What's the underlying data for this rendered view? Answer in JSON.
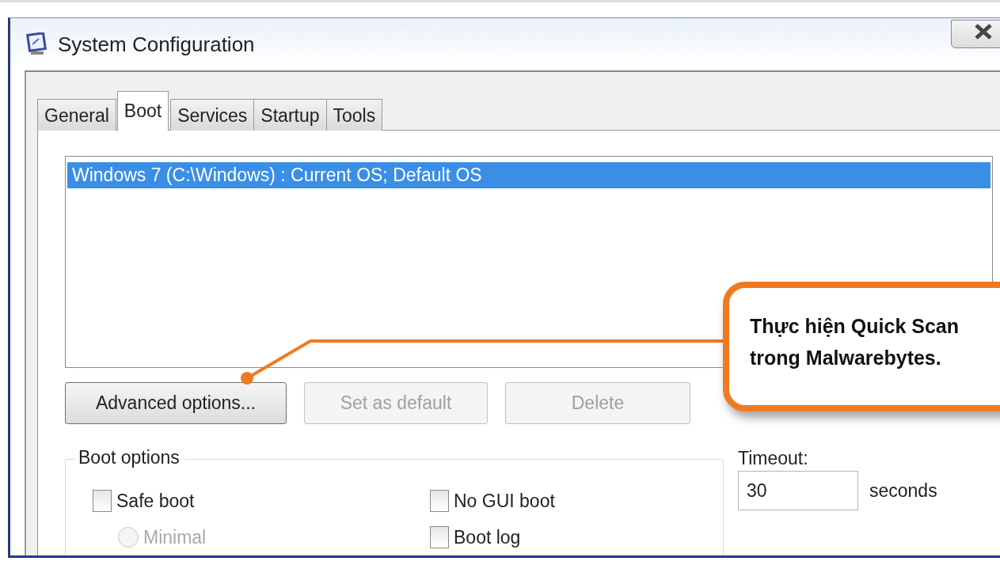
{
  "window": {
    "title": "System Configuration"
  },
  "tabs": [
    {
      "label": "General",
      "selected": false
    },
    {
      "label": "Boot",
      "selected": true
    },
    {
      "label": "Services",
      "selected": false
    },
    {
      "label": "Startup",
      "selected": false
    },
    {
      "label": "Tools",
      "selected": false
    }
  ],
  "boot_entries": [
    {
      "label": "Windows 7 (C:\\Windows) : Current OS; Default OS",
      "selected": true
    }
  ],
  "buttons": [
    {
      "label": "Advanced options...",
      "disabled": false
    },
    {
      "label": "Set as default",
      "disabled": true
    },
    {
      "label": "Delete",
      "disabled": true
    }
  ],
  "boot_options": {
    "title": "Boot options",
    "items": [
      {
        "kind": "checkbox",
        "label": "Safe boot",
        "checked": false,
        "disabled": false
      },
      {
        "kind": "checkbox",
        "label": "No GUI boot",
        "checked": false,
        "disabled": false
      },
      {
        "kind": "radio",
        "label": "Minimal",
        "checked": false,
        "disabled": true
      },
      {
        "kind": "checkbox",
        "label": "Boot log",
        "checked": false,
        "disabled": false
      }
    ]
  },
  "timeout": {
    "label": "Timeout:",
    "value": "30",
    "unit": "seconds"
  },
  "callout": {
    "lines": [
      "Thực hiện Quick Scan",
      "trong Malwarebytes."
    ]
  }
}
